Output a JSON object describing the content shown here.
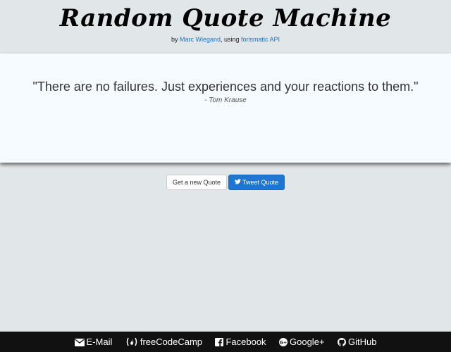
{
  "header": {
    "title": "Random Quote Machine",
    "byline_prefix": "by ",
    "author_link": "Marc Wiegand",
    "byline_mid": ", using ",
    "api_link": "forismatic API"
  },
  "quote": {
    "text": "\"There are no failures. Just experiences and your reactions to them.\"",
    "author": "- Tom Krause"
  },
  "actions": {
    "new_quote_label": "Get a new Quote",
    "tweet_label": "Tweet Quote"
  },
  "footer": {
    "links": [
      {
        "label": "E-Mail",
        "icon": "envelope-icon"
      },
      {
        "label": "freeCodeCamp",
        "icon": "freecodecamp-icon"
      },
      {
        "label": "Facebook",
        "icon": "facebook-icon"
      },
      {
        "label": "Google+",
        "icon": "google-plus-icon"
      },
      {
        "label": "GitHub",
        "icon": "github-icon"
      }
    ]
  },
  "colors": {
    "background": "#e1e6e8",
    "quote_panel": "#f5fbfe",
    "link": "#1f73c8",
    "primary_button": "#1f76d0",
    "footer": "#111111"
  }
}
